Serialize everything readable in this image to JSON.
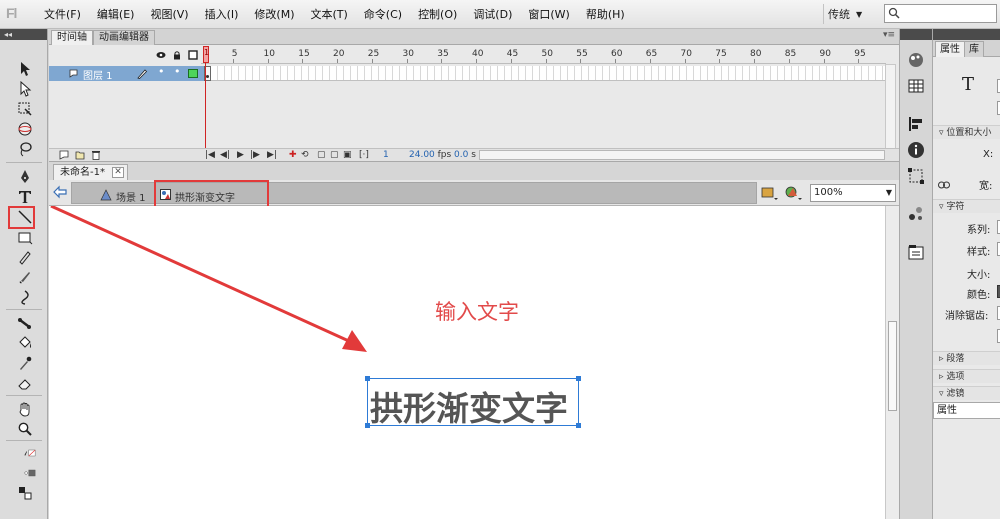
{
  "app": {
    "logo": "Fl"
  },
  "menu": {
    "items": [
      "文件(F)",
      "编辑(E)",
      "视图(V)",
      "插入(I)",
      "修改(M)",
      "文本(T)",
      "命令(C)",
      "控制(O)",
      "调试(D)",
      "窗口(W)",
      "帮助(H)"
    ],
    "workspace": "传统",
    "search_placeholder": ""
  },
  "timeline": {
    "tabs": [
      "时间轴",
      "动画编辑器"
    ],
    "ruler": [
      "1",
      "5",
      "10",
      "15",
      "20",
      "25",
      "30",
      "35",
      "40",
      "45",
      "50",
      "55",
      "60",
      "65",
      "70",
      "75",
      "80",
      "85",
      "90",
      "95"
    ],
    "layer_name": "图层 1",
    "current_frame": "1",
    "fps": "24.00",
    "fps_unit": "fps",
    "time": "0.0",
    "time_unit": "s"
  },
  "document": {
    "tab_title": "未命名-1*",
    "scene_label": "场景 1",
    "symbol_label": "拱形渐变文字",
    "zoom": "100%"
  },
  "stage": {
    "annotation": "输入文字",
    "text_content": "拱形渐变文字",
    "annotation_color": "#e24a4a",
    "highlight_color": "#e23a3a",
    "selection_color": "#2e7bd6"
  },
  "properties": {
    "tabs": [
      "属性",
      "库"
    ],
    "sections": {
      "position_size": "位置和大小",
      "character": "字符",
      "paragraph": "段落",
      "options": "选项",
      "filters": "滤镜"
    },
    "labels": {
      "x": "X:",
      "width": "宽:",
      "family": "系列:",
      "style": "样式:",
      "size": "大小:",
      "color": "颜色:",
      "antialias": "消除锯齿:"
    },
    "bottom_label": "属性"
  }
}
